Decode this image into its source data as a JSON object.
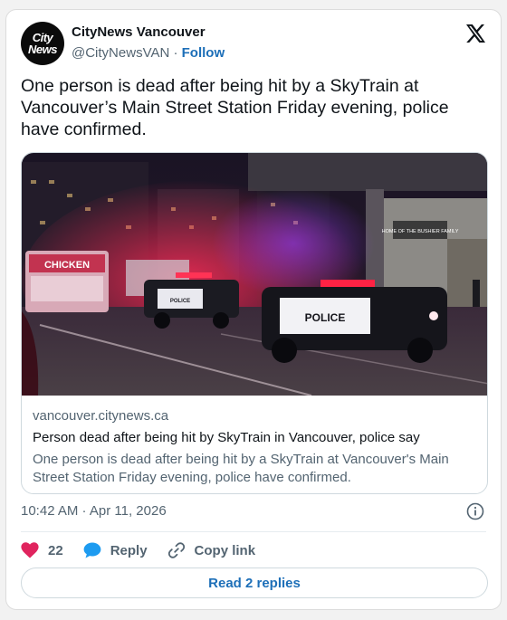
{
  "account": {
    "avatar_line1": "City",
    "avatar_line2": "News",
    "name": "CityNews Vancouver",
    "handle": "@CityNewsVAN",
    "separator": " · ",
    "follow_label": "Follow"
  },
  "tweet": {
    "text": "One person is dead after being hit by a SkyTrain at Vancouver’s Main Street Station Friday evening, police have confirmed.",
    "timestamp": "10:42 AM · Apr 11, 2026"
  },
  "link_card": {
    "domain": "vancouver.citynews.ca",
    "title": "Person dead after being hit by SkyTrain in Vancouver, police say",
    "description": "One person is dead after being hit by a SkyTrain at Vancouver's Main Street Station Friday evening, police have confirmed.",
    "photo_text": {
      "bus_sign": "CHICKEN",
      "police_label": "POLICE",
      "police_label_small": "POLICE",
      "station_sign": "HOME OF THE BUSHIER FAMILY"
    }
  },
  "actions": {
    "like_count": "22",
    "reply_label": "Reply",
    "copy_link_label": "Copy link",
    "read_replies_label": "Read 2 replies"
  },
  "colors": {
    "accent": "#1d6fb8",
    "like": "#e0245e",
    "reply_bubble": "#1d9bf0",
    "text_secondary": "#536471"
  },
  "icons": {
    "brand": "x-logo-icon",
    "info": "info-icon",
    "like": "heart-icon",
    "reply": "speech-bubble-icon",
    "copy": "link-icon"
  }
}
